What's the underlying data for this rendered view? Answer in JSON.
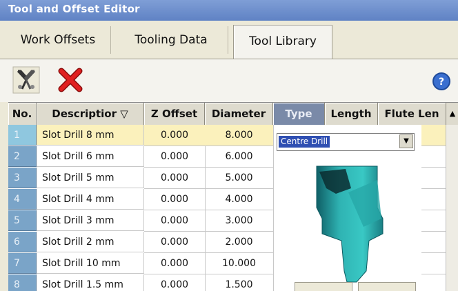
{
  "window": {
    "title": "Tool and Offset Editor"
  },
  "tabs": [
    {
      "label": "Work Offsets",
      "active": false
    },
    {
      "label": "Tooling Data",
      "active": false
    },
    {
      "label": "Tool Library",
      "active": true
    }
  ],
  "toolbar": {
    "tools_icon": "tools-icon",
    "delete_icon": "delete-x-icon",
    "help_icon": "help-icon"
  },
  "grid": {
    "columns": [
      "No.",
      "Descriptior ▽",
      "Z Offset",
      "Diameter",
      "Type",
      "Length",
      "Flute Len"
    ],
    "rows": [
      {
        "no": "1",
        "description": "Slot Drill 8 mm",
        "z_offset": "0.000",
        "diameter": "8.000",
        "selected": true
      },
      {
        "no": "2",
        "description": "Slot Drill 6 mm",
        "z_offset": "0.000",
        "diameter": "6.000"
      },
      {
        "no": "3",
        "description": "Slot Drill 5 mm",
        "z_offset": "0.000",
        "diameter": "5.000"
      },
      {
        "no": "4",
        "description": "Slot Drill 4 mm",
        "z_offset": "0.000",
        "diameter": "4.000"
      },
      {
        "no": "5",
        "description": "Slot Drill 3 mm",
        "z_offset": "0.000",
        "diameter": "3.000"
      },
      {
        "no": "6",
        "description": "Slot Drill 2 mm",
        "z_offset": "0.000",
        "diameter": "2.000"
      },
      {
        "no": "7",
        "description": "Slot Drill 10 mm",
        "z_offset": "0.000",
        "diameter": "10.000"
      },
      {
        "no": "8",
        "description": "Slot Drill 1.5 mm",
        "z_offset": "0.000",
        "diameter": "1.500"
      }
    ]
  },
  "type_dropdown": {
    "selected": "Centre Drill",
    "preview_icon": "centre-drill-tool-preview"
  },
  "colors": {
    "titlebar": "#6f90cd",
    "row_number_bg": "#7aa4c8",
    "selected_row": "#fbf1bc",
    "tool_preview": "#2fb3b3"
  }
}
